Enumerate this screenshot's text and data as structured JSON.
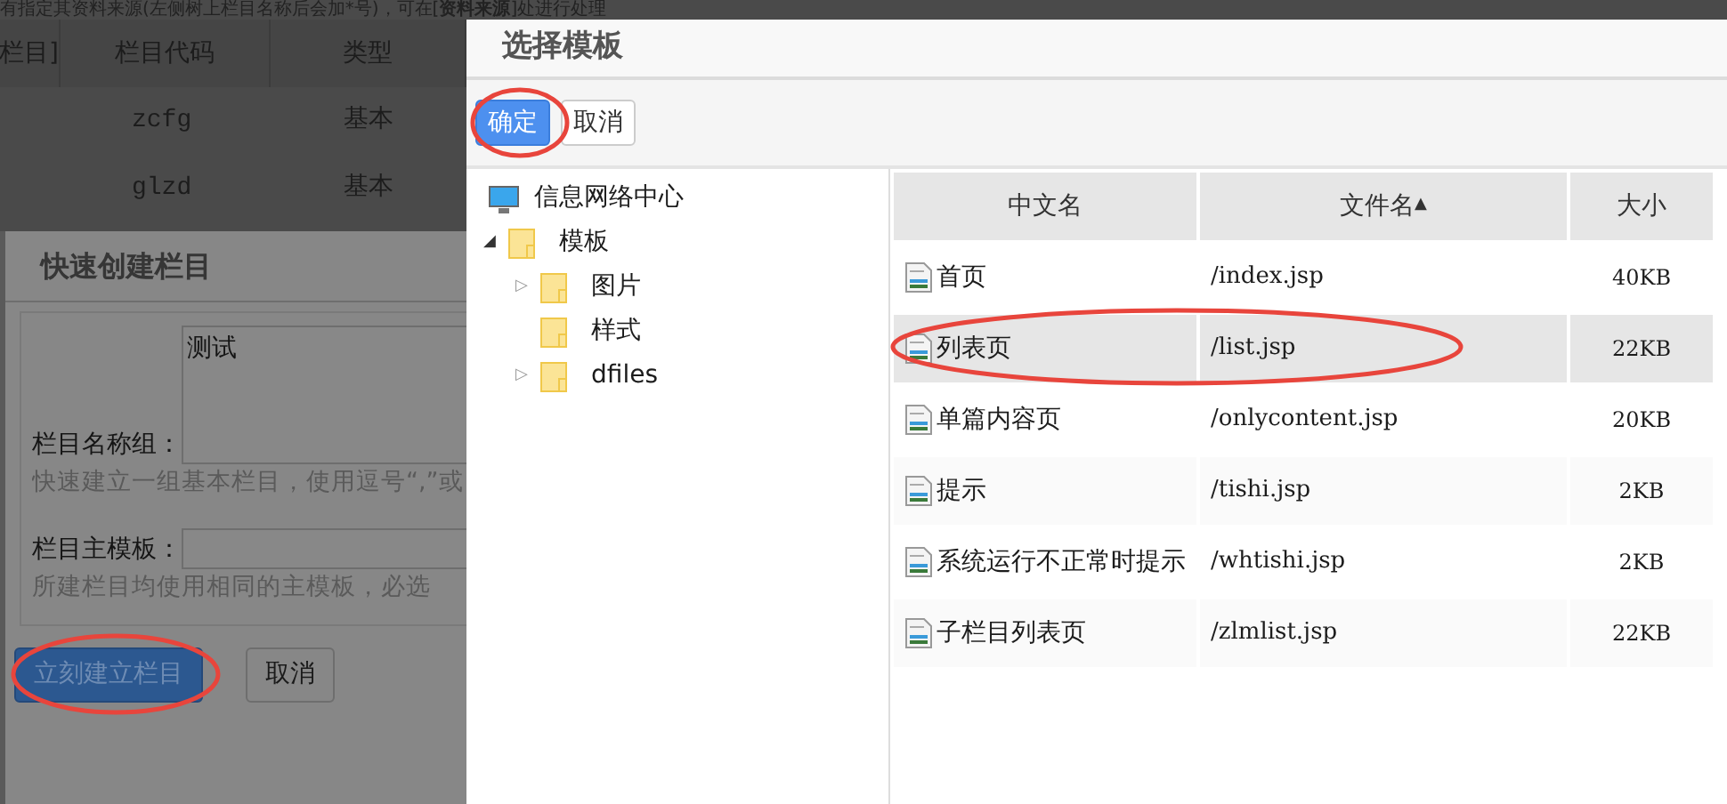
{
  "background_page": {
    "notice_text": "有指定其资料来源(左侧树上栏目名称后会加*号)，可在[**资料来源**]处进行处理",
    "table": {
      "columns": [
        "栏目]",
        "栏目代码",
        "类型"
      ],
      "rows": [
        {
          "code": "zcfg",
          "type": "基本"
        },
        {
          "code": "glzd",
          "type": "基本"
        }
      ]
    }
  },
  "quick_create_dialog": {
    "title": "快速创建栏目",
    "fields": [
      {
        "kind": "textarea",
        "label": "栏目名称组：",
        "value": "测试",
        "hint": "快速建立一组基本栏目，使用逗号“,”或"
      },
      {
        "kind": "input",
        "label": "栏目主模板：",
        "hint": "所建栏目均使用相同的主模板，必选"
      }
    ],
    "buttons": [
      {
        "label": "立刻建立栏目",
        "kind": "primary",
        "annotated": true
      },
      {
        "label": "取消",
        "kind": "default",
        "annotated": false
      }
    ]
  },
  "select_template_dialog": {
    "title": "选择模板",
    "buttons": [
      {
        "label": "确定",
        "kind": "primary",
        "annotated": true
      },
      {
        "label": "取消",
        "kind": "default",
        "annotated": false
      }
    ],
    "tree": [
      {
        "label": "信息网络中心",
        "kind": "computer"
      },
      {
        "label": "模板",
        "kind": "folder",
        "toggle": "◢",
        "expanded": true,
        "children": [
          {
            "label": "图片",
            "kind": "folder",
            "toggle": "▷",
            "expanded": false
          },
          {
            "label": "样式",
            "kind": "folder"
          },
          {
            "label": "dfiles",
            "kind": "folder",
            "toggle": "▷",
            "expanded": false
          }
        ]
      }
    ],
    "table": {
      "columns": [
        {
          "label": "中文名"
        },
        {
          "label": "文件名",
          "sort": "▲"
        },
        {
          "label": "大小"
        }
      ],
      "rows": [
        {
          "name": "首页",
          "file": "/index.jsp",
          "size": "40KB",
          "selected": false,
          "annotated": false
        },
        {
          "name": "列表页",
          "file": "/list.jsp",
          "size": "22KB",
          "selected": true,
          "annotated": true
        },
        {
          "name": "单篇内容页",
          "file": "/onlycontent.jsp",
          "size": "20KB",
          "selected": false,
          "annotated": false
        },
        {
          "name": "提示",
          "file": "/tishi.jsp",
          "size": "2KB",
          "selected": false,
          "annotated": false
        },
        {
          "name": "系统运行不正常时提示",
          "file": "/whtishi.jsp",
          "size": "2KB",
          "selected": false,
          "annotated": false
        },
        {
          "name": "子栏目列表页",
          "file": "/zlmlist.jsp",
          "size": "22KB",
          "selected": false,
          "annotated": false
        }
      ]
    }
  }
}
